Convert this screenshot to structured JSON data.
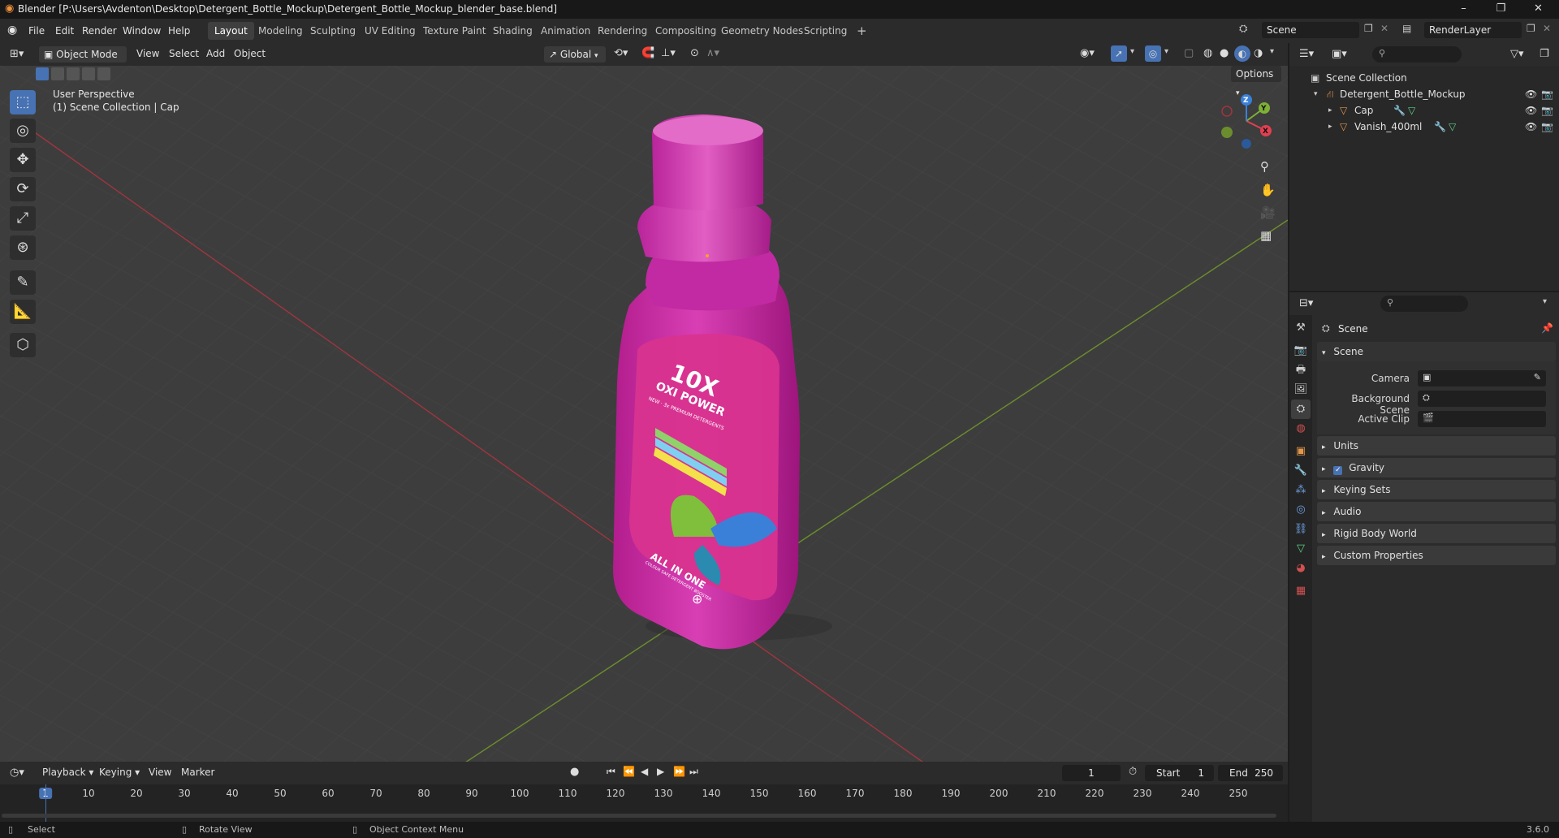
{
  "window": {
    "title": "Blender [P:\\Users\\Avdenton\\Desktop\\Detergent_Bottle_Mockup\\Detergent_Bottle_Mockup_blender_base.blend]",
    "minimize": "–",
    "maximize": "❐",
    "close": "✕"
  },
  "menu": [
    "File",
    "Edit",
    "Render",
    "Window",
    "Help"
  ],
  "workspaces": [
    "Layout",
    "Modeling",
    "Sculpting",
    "UV Editing",
    "Texture Paint",
    "Shading",
    "Animation",
    "Rendering",
    "Compositing",
    "Geometry Nodes",
    "Scripting"
  ],
  "workspace_add": "+",
  "scene_selector": {
    "value": "Scene"
  },
  "renderlayer_selector": {
    "value": "RenderLayer"
  },
  "viewport_header": {
    "mode": "Object Mode",
    "menus": [
      "View",
      "Select",
      "Add",
      "Object"
    ],
    "transform_orientation": "Global",
    "options_label": "Options"
  },
  "viewport": {
    "perspective": "User Perspective",
    "collection_info": "(1) Scene Collection | Cap",
    "gizmo": {
      "x": "X",
      "y": "Y",
      "z": "Z"
    }
  },
  "bottle_label": {
    "line1": "10X",
    "line2": "OXI POWER",
    "line3": "NEW · 3x PREMIUM DETERGENTS",
    "line4": "ALL IN ONE",
    "line5": "COLOUR SAFE DETERGENT BOOSTER",
    "body_color": "#c4259f",
    "label_color": "#d8338f"
  },
  "timeline": {
    "menus": [
      "Playback",
      "Keying",
      "View",
      "Marker"
    ],
    "current_frame": "1",
    "start_label": "Start",
    "start_value": "1",
    "end_label": "End",
    "end_value": "250",
    "ticks": [
      "1",
      "10",
      "20",
      "30",
      "40",
      "50",
      "60",
      "70",
      "80",
      "90",
      "100",
      "110",
      "120",
      "130",
      "140",
      "150",
      "160",
      "170",
      "180",
      "190",
      "200",
      "210",
      "220",
      "230",
      "240",
      "250"
    ]
  },
  "statusbar": {
    "select": "Select",
    "rotate": "Rotate View",
    "context": "Object Context Menu",
    "version": "3.6.0"
  },
  "outliner": {
    "root": "Scene Collection",
    "items": [
      {
        "name": "Detergent_Bottle_Mockup",
        "level": 1
      },
      {
        "name": "Cap",
        "level": 2
      },
      {
        "name": "Vanish_400ml",
        "level": 2
      }
    ]
  },
  "properties": {
    "header": "Scene",
    "section": "Scene",
    "camera_label": "Camera",
    "background_label": "Background Scene",
    "clip_label": "Active Clip",
    "panels": [
      "Units",
      "Gravity",
      "Keying Sets",
      "Audio",
      "Rigid Body World",
      "Custom Properties"
    ]
  },
  "colors": {
    "accent": "#4772b3",
    "x_axis": "#e04050",
    "y_axis": "#7fb036",
    "z_axis": "#3a80d8"
  }
}
